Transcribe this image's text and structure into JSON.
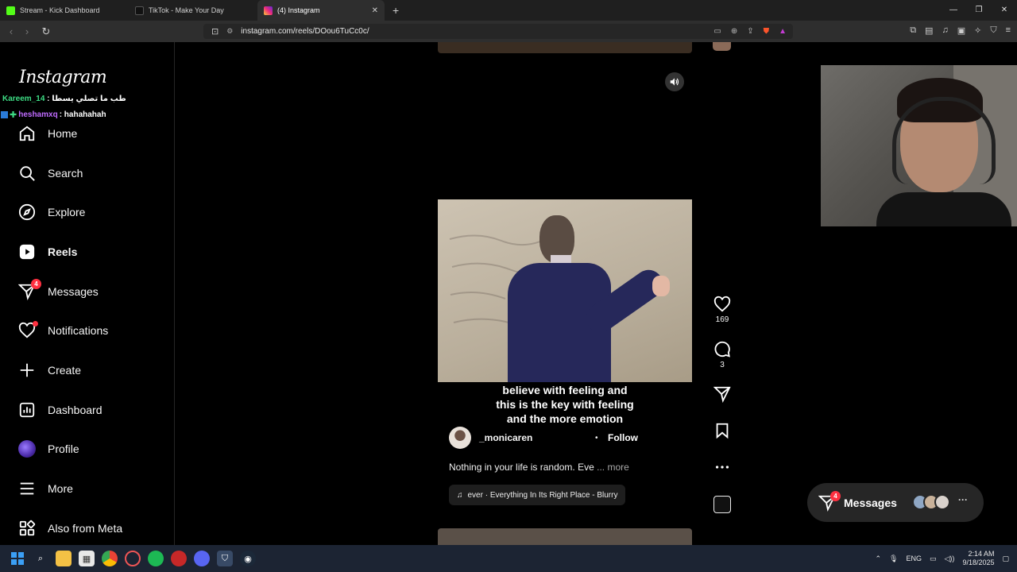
{
  "browser": {
    "tabs": [
      {
        "label": "Stream - Kick Dashboard",
        "favicon_color": "#53fc18"
      },
      {
        "label": "TikTok - Make Your Day",
        "favicon_color": "#111111"
      },
      {
        "label": "(4) Instagram",
        "favicon_color": "#e1306c"
      }
    ],
    "url": "instagram.com/reels/DOou6TuCc0c/"
  },
  "sidebar": {
    "logo": "Instagram",
    "chat": [
      {
        "user": "Kareem_14",
        "message": " : طب ما تصلي يسطا"
      },
      {
        "user": "heshamxq",
        "message": " : hahahahah"
      }
    ],
    "items": [
      {
        "label": "Home"
      },
      {
        "label": "Search"
      },
      {
        "label": "Explore"
      },
      {
        "label": "Reels"
      },
      {
        "label": "Messages",
        "badge": "4"
      },
      {
        "label": "Notifications"
      },
      {
        "label": "Create"
      },
      {
        "label": "Dashboard"
      },
      {
        "label": "Profile"
      },
      {
        "label": "More"
      },
      {
        "label": "Also from Meta"
      }
    ]
  },
  "reel": {
    "caption_lines": [
      "believe with feeling and",
      "this is the key with feeling",
      "and the more emotion"
    ],
    "author": "_monicaren",
    "separator": "•",
    "follow_label": "Follow",
    "description": "Nothing in your life is random. Eve",
    "more_label": "... more",
    "music": "ever · Everything In Its Right Place - Blurry",
    "likes": "169",
    "comments": "3"
  },
  "messages_pill": {
    "label": "Messages",
    "badge": "4"
  },
  "taskbar": {
    "lang": "ENG",
    "time": "2:14 AM",
    "date": "9/18/2025"
  }
}
